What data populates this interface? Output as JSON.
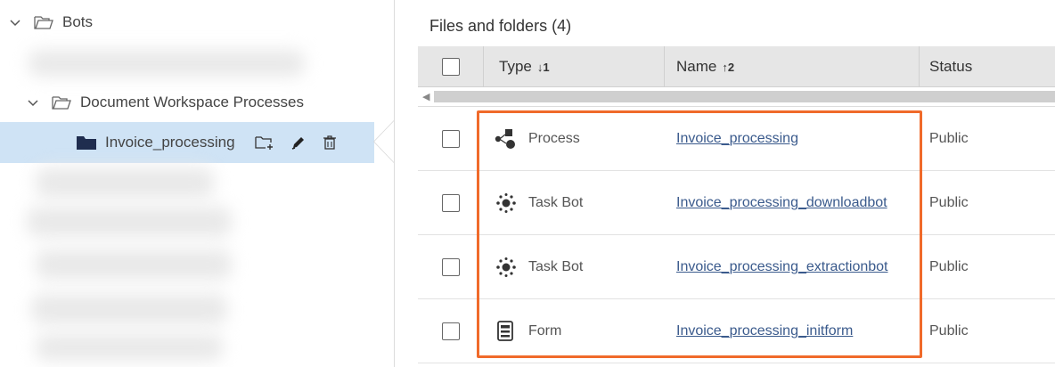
{
  "tree": {
    "root_label": "Bots",
    "folder_label": "Document Workspace Processes",
    "selected_label": "Invoice_processing"
  },
  "main": {
    "heading": "Files and folders",
    "count": "(4)",
    "columns": {
      "type": "Type",
      "type_sort": "1",
      "name": "Name",
      "name_sort": "2",
      "status": "Status"
    },
    "rows": [
      {
        "type": "Process",
        "name": "Invoice_processing",
        "status": "Public",
        "icon": "process-icon"
      },
      {
        "type": "Task Bot",
        "name": "Invoice_processing_downloadbot",
        "status": "Public",
        "icon": "taskbot-icon"
      },
      {
        "type": "Task Bot",
        "name": "Invoice_processing_extractionbot",
        "status": "Public",
        "icon": "taskbot-icon"
      },
      {
        "type": "Form",
        "name": "Invoice_processing_initform",
        "status": "Public",
        "icon": "form-icon"
      }
    ]
  },
  "colors": {
    "highlight": "#f06a2a",
    "selected_bg": "#cfe3f5",
    "link": "#3a5a8c"
  }
}
